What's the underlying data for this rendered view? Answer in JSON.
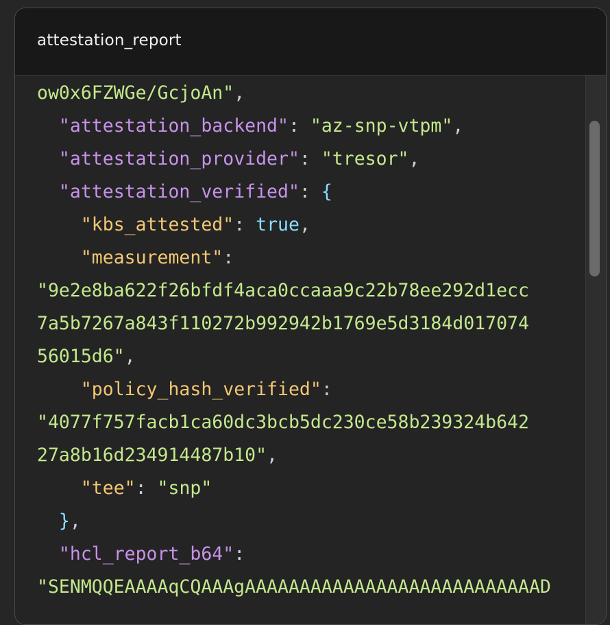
{
  "panel": {
    "title": "attestation_report"
  },
  "code": {
    "l0_str": "ow0x6FZWGe/GcjoAn\"",
    "l0_comma": ",",
    "l1_indent": "  ",
    "l1_key": "\"attestation_backend\"",
    "l1_colon": ": ",
    "l1_val": "\"az-snp-vtpm\"",
    "l1_comma": ",",
    "l2_indent": "  ",
    "l2_key": "\"attestation_provider\"",
    "l2_colon": ": ",
    "l2_val": "\"tresor\"",
    "l2_comma": ",",
    "l3_indent": "  ",
    "l3_key": "\"attestation_verified\"",
    "l3_colon": ": ",
    "l3_brace": "{",
    "l4_indent": "    ",
    "l4_key": "\"kbs_attested\"",
    "l4_colon": ": ",
    "l4_val": "true",
    "l4_comma": ",",
    "l5_indent": "    ",
    "l5_key": "\"measurement\"",
    "l5_colon": ":",
    "l6_str": "\"9e2e8ba622f26bfdf4aca0ccaaa9c22b78ee292d1ecc",
    "l7_str": "7a5b7267a843f110272b992942b1769e5d3184d017074",
    "l8_str": "56015d6\"",
    "l8_comma": ",",
    "l9_indent": "    ",
    "l9_key": "\"policy_hash_verified\"",
    "l9_colon": ":",
    "l10_str": "\"4077f757facb1ca60dc3bcb5dc230ce58b239324b642",
    "l11_str": "27a8b16d234914487b10\"",
    "l11_comma": ",",
    "l12_indent": "    ",
    "l12_key": "\"tee\"",
    "l12_colon": ": ",
    "l12_val": "\"snp\"",
    "l13_indent": "  ",
    "l13_brace": "}",
    "l13_comma": ",",
    "l14_indent": "  ",
    "l14_key": "\"hcl_report_b64\"",
    "l14_colon": ":",
    "l15_str": "\"SENMQQEAAAAqCQAAAgAAAAAAAAAAAAAAAAAAAAAAAAAAAD"
  },
  "colors": {
    "key_primary": "#c792ea",
    "key_nested": "#f4c773",
    "string": "#c3e88d",
    "punctuation": "#c7d0dc",
    "boolean_and_brace": "#89ddff",
    "header_bg": "#181818",
    "body_bg": "#242424"
  }
}
